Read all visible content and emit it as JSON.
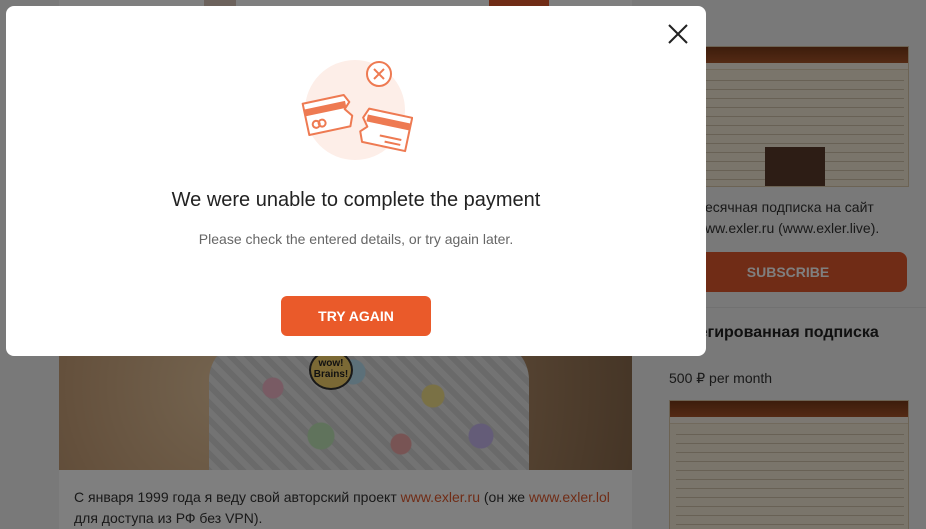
{
  "background": {
    "intro": {
      "prefix": "С января 1999 года я веду свой авторский проект ",
      "link1": "www.exler.ru",
      "middle": " (он же ",
      "link2": "www.exler.lol",
      "suffix": " для доступа из РФ без VPN)."
    },
    "shirt_badge": "wow! Brains!",
    "sidebar": {
      "subscription_text": "есячная подписка на сайт ww.exler.ru (www.exler.live).",
      "subscribe_label": "SUBSCRIBE",
      "privileged_title": "вилегированная подписка",
      "privileged_price": "500 ₽ per month"
    }
  },
  "modal": {
    "title": "We were unable to complete the payment",
    "subtitle": "Please check the entered details, or try again later.",
    "button_label": "TRY AGAIN",
    "close_icon": "close-icon",
    "illustration_icon": "broken-card-icon"
  },
  "colors": {
    "accent": "#ea5a2a",
    "illustration_stroke": "#ee7a52",
    "illustration_bg": "#fdeee8"
  }
}
